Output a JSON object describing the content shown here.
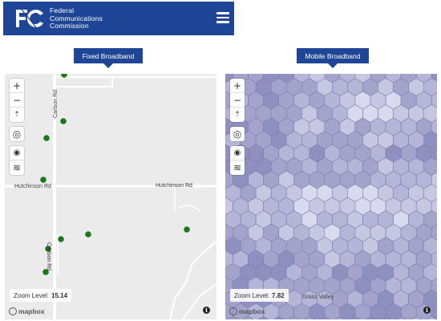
{
  "header": {
    "agency_line1": "Federal",
    "agency_line2": "Communications",
    "agency_line3": "Commission",
    "logo_icon": "fcc-logo-icon",
    "menu_icon": "hamburger-menu-icon",
    "background_color": "#1f4597"
  },
  "tabs": {
    "fixed_label": "Fixed Broadband",
    "mobile_label": "Mobile Broadband"
  },
  "fixed_map": {
    "controls": {
      "zoom_in": "+",
      "zoom_out": "−",
      "compass": "⇡",
      "geolocate": "◎",
      "globe": "◉",
      "layers": "≋"
    },
    "road_labels": {
      "carlson_top": "Carlson Rd",
      "hutchinson_left": "Hutchinson Rd",
      "hutchinson_right": "Hutchinson Rd",
      "carlson_bottom": "Carlson Rd"
    },
    "zoom_label": "Zoom Level:",
    "zoom_value": "15.14",
    "attribution": "mapbox",
    "info": "i",
    "marker_color": "#1a7a1a"
  },
  "mobile_map": {
    "controls": {
      "zoom_in": "+",
      "zoom_out": "−",
      "compass": "⇡",
      "geolocate": "◎",
      "globe": "◉",
      "layers": "≋"
    },
    "place_label": "Grass Valley",
    "zoom_label": "Zoom Level:",
    "zoom_value": "7.82",
    "attribution": "mapbox",
    "info": "i",
    "hex_colors": [
      "#8f8fc0",
      "#a3a3cc",
      "#b5b5d7",
      "#c7c7e2",
      "#dadaee"
    ]
  }
}
